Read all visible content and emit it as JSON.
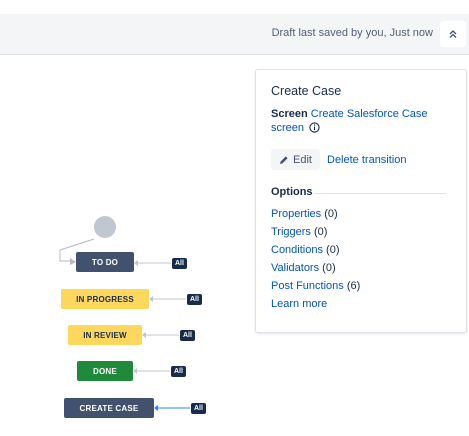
{
  "header": {
    "saved_text": "Draft last saved by you, Just now",
    "collapse_icon": "double-chevron-up-icon"
  },
  "diagram": {
    "statuses": [
      {
        "label": "TO DO",
        "color": "#42526e"
      },
      {
        "label": "IN PROGRESS",
        "color": "#fdd85d"
      },
      {
        "label": "IN REVIEW",
        "color": "#fdd85d"
      },
      {
        "label": "DONE",
        "color": "#1e8a3a"
      },
      {
        "label": "CREATE CASE",
        "color": "#42526e"
      }
    ],
    "all_badge": "All",
    "selected_arrow_color": "#2684ff"
  },
  "panel": {
    "title": "Create Case",
    "screen_label": "Screen",
    "screen_link": "Create Salesforce Case screen",
    "edit_label": "Edit",
    "delete_label": "Delete transition",
    "options_heading": "Options",
    "options": [
      {
        "label": "Properties",
        "count": "(0)"
      },
      {
        "label": "Triggers",
        "count": "(0)"
      },
      {
        "label": "Conditions",
        "count": "(0)"
      },
      {
        "label": "Validators",
        "count": "(0)"
      },
      {
        "label": "Post Functions",
        "count": "(6)"
      }
    ],
    "learn_more": "Learn more"
  }
}
